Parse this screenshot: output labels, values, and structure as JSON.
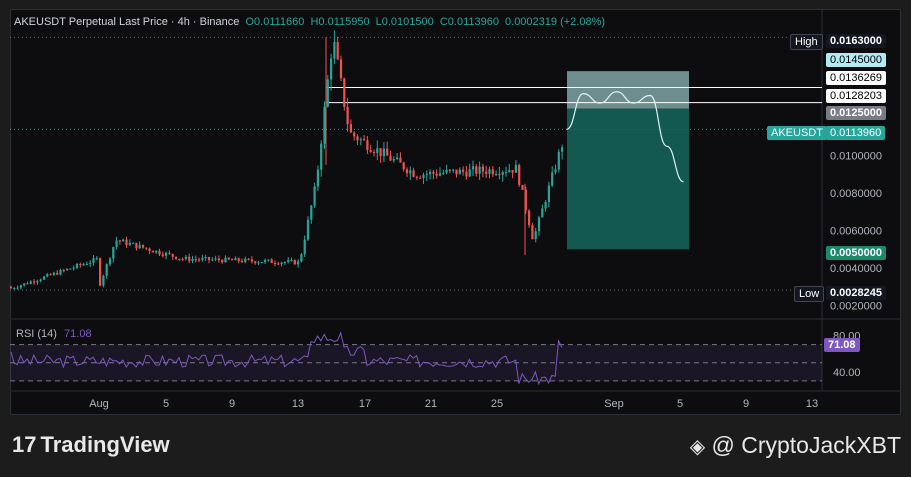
{
  "header": {
    "symbol": "AKEUSDT Perpetual Last Price · 4h · Binance",
    "open": "O0.0111660",
    "high": "H0.0115950",
    "low": "L0.0101500",
    "close": "C0.0113960",
    "change": "0.0002319 (+2.08%)"
  },
  "price_tags": {
    "high_label": "High",
    "high_value": "0.0163000",
    "low_label": "Low",
    "low_value": "0.0028245",
    "symbol_label": "AKEUSDT",
    "last_value": "0.0113960",
    "target_1": "0.0145000",
    "target_2": "0.0136269",
    "target_3": "0.0128203",
    "entry": "0.0125000",
    "stop": "0.0050000"
  },
  "rsi": {
    "label": "RSI (14)",
    "value": "71.08",
    "tag": "71.08"
  },
  "colors": {
    "up": "#26a69a",
    "down": "#ef5350",
    "rsi": "#7e57c2",
    "accent": "#2962ff"
  },
  "footer": {
    "brand": "TradingView",
    "watermark": "@ CryptoJackXBT"
  },
  "chart_data": {
    "type": "candlestick",
    "price_axis": {
      "ticks": [
        "0.0020000",
        "0.0040000",
        "0.0060000",
        "0.0080000",
        "0.0100000"
      ],
      "ylim": [
        0.0015,
        0.0168
      ]
    },
    "time_axis": {
      "ticks": [
        "Aug",
        "5",
        "9",
        "13",
        "17",
        "21",
        "25",
        "Sep",
        "5",
        "9",
        "13"
      ]
    },
    "rsi_axis": {
      "ticks": [
        "80.00",
        "40.00"
      ],
      "overbought": 70,
      "oversold": 30,
      "ylim": [
        20,
        95
      ]
    },
    "horizontal_levels": [
      0.0163,
      0.0028245
    ],
    "position": {
      "entry": 0.0125,
      "take_profit": 0.0145,
      "stop": 0.005
    },
    "key_points": [
      {
        "t": "Aug 1",
        "price": 0.003
      },
      {
        "t": "Aug 2",
        "price": 0.0055
      },
      {
        "t": "Aug 6",
        "price": 0.0045
      },
      {
        "t": "Aug 13",
        "price": 0.0043
      },
      {
        "t": "Aug 14",
        "price": 0.0085
      },
      {
        "t": "Aug 15",
        "price": 0.0163
      },
      {
        "t": "Aug 16",
        "price": 0.0112
      },
      {
        "t": "Aug 20",
        "price": 0.009
      },
      {
        "t": "Aug 26",
        "price": 0.0093
      },
      {
        "t": "Aug 27",
        "price": 0.0055
      },
      {
        "t": "Aug 29",
        "price": 0.0114
      }
    ],
    "projection": [
      {
        "t": "Aug 29",
        "price": 0.0114
      },
      {
        "t": "Aug 30",
        "price": 0.0133
      },
      {
        "t": "Aug 31",
        "price": 0.0128
      },
      {
        "t": "Sep 1",
        "price": 0.0134
      },
      {
        "t": "Sep 2",
        "price": 0.0128
      },
      {
        "t": "Sep 3",
        "price": 0.0132
      },
      {
        "t": "Sep 4",
        "price": 0.0105
      },
      {
        "t": "Sep 5",
        "price": 0.0086
      }
    ]
  }
}
